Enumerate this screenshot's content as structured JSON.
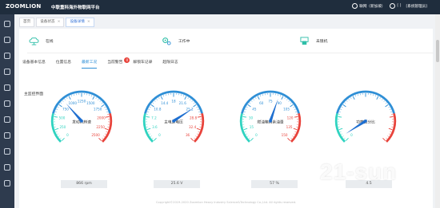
{
  "header": {
    "logo": "ZOOMLION",
    "platform": "中联重科海外物联网平台",
    "user_location": "联网（新加坡）",
    "account": "[ ]",
    "system_manage": "[系统管理员]"
  },
  "tabs": [
    {
      "label": "首页",
      "closable": false,
      "active": false
    },
    {
      "label": "设备状态",
      "closable": true,
      "active": false
    },
    {
      "label": "设备详情",
      "closable": true,
      "active": true
    }
  ],
  "status": [
    {
      "label": "在线",
      "icon": "cloud-online-icon"
    },
    {
      "label": "工作中",
      "icon": "gears-working-icon"
    },
    {
      "label": "未锁机",
      "icon": "unlock-icon"
    }
  ],
  "subtabs": [
    {
      "label": "设备基本信息",
      "active": false
    },
    {
      "label": "位置信息",
      "active": false
    },
    {
      "label": "最新工况",
      "active": true
    },
    {
      "label": "当前警告",
      "active": false,
      "badge": "0"
    },
    {
      "label": "解锁车记录",
      "active": false
    },
    {
      "label": "超限日志",
      "active": false
    }
  ],
  "section_title": "主监控界面",
  "gauges": [
    {
      "title": "发动机转速",
      "ticks": [
        "0",
        "250",
        "500",
        "750",
        "1000",
        "1250",
        "1500",
        "1750",
        "2000",
        "2250",
        "2500"
      ],
      "value": 866,
      "max": 2500,
      "readout": "866  rpm"
    },
    {
      "title": "主电源电压",
      "ticks": [
        "0",
        "3.6",
        "7.2",
        "10.8",
        "14.4",
        "18",
        "21.6",
        "25.2",
        "28.8",
        "32.4",
        "36"
      ],
      "value": 25.6,
      "max": 36,
      "readout": "25.6  V"
    },
    {
      "title": "燃油箱剩余油量",
      "ticks": [
        "0",
        "15",
        "30",
        "45",
        "60",
        "75",
        "90",
        "105",
        "120",
        "135",
        "150"
      ],
      "value": 57,
      "max": 100,
      "readout": "57  %"
    },
    {
      "title": "功率百分比",
      "ticks": [
        "0",
        "",
        "",
        "",
        "",
        "",
        "",
        "",
        "",
        "",
        ""
      ],
      "value": 4.5,
      "max": 100,
      "readout": "4.5"
    }
  ],
  "footer": "Copyright©2019-2020 Zoomlion Heavy Industry Science&Technology Co.,Ltd. All rights reserved.",
  "watermark": "21-sun",
  "colors": {
    "topbar": "#1f2d3d",
    "sidebar": "#2e3b4e",
    "gauge_start": "#2fd3c0",
    "gauge_mid": "#2f8fd6",
    "gauge_end": "#e8433b",
    "needle": "#1f6fd0"
  }
}
